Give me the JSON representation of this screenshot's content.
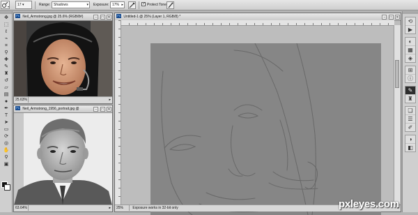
{
  "options_bar": {
    "brush_size": "17",
    "range_label": "Range:",
    "range_value": "Shadows",
    "exposure_label": "Exposure:",
    "exposure_value": "17%",
    "protect_tones_label": "Protect Tones",
    "protect_tones_checked": true
  },
  "tools": [
    "move",
    "marquee",
    "lasso",
    "quick-select",
    "crop",
    "eyedropper",
    "healing",
    "brush",
    "clone-stamp",
    "history-brush",
    "eraser",
    "gradient",
    "dodge",
    "pen",
    "type",
    "path-select",
    "shape",
    "hand",
    "zoom",
    "3d-rotate",
    "3d-orbit",
    "note",
    "count"
  ],
  "documents": [
    {
      "title": "Neil_Armstrong.jpg @ 25.6% (RGB/8#)",
      "zoom": "25.63%"
    },
    {
      "title": "Neil_Armstrong_1956_portrait.jpg @",
      "zoom": "63.64%"
    },
    {
      "title": "Untitled-1 @ 25% (Layer 1, RGB/8) *",
      "zoom": "25%",
      "status_info": "Exposure works in 32-bit only"
    }
  ],
  "window_buttons": {
    "minimize": "–",
    "maximize": "□",
    "close": "✕"
  },
  "dock_icons": [
    "history-icon",
    "actions-icon",
    "color-icon",
    "swatches-icon",
    "styles-icon",
    "navigator-icon",
    "info-icon",
    "brushes-icon",
    "clone-source-icon",
    "layers-icon",
    "channels-icon",
    "paths-icon",
    "adjustments-icon",
    "masks-icon"
  ],
  "watermark": "pxleyes.com"
}
